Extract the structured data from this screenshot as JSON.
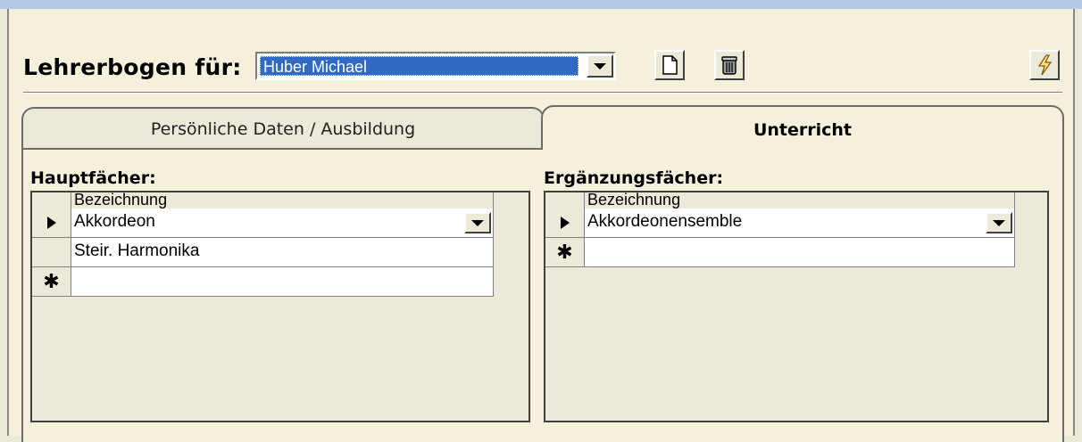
{
  "header": {
    "title": "Lehrerbogen für:",
    "teacher_value": "Huber Michael"
  },
  "toolbar": {
    "new_icon": "document-icon",
    "delete_icon": "trash-icon",
    "action_icon": "lightning-icon"
  },
  "tabs": [
    {
      "label": "Persönliche Daten / Ausbildung",
      "active": false
    },
    {
      "label": "Unterricht",
      "active": true
    }
  ],
  "hauptfaecher": {
    "label": "Hauptfächer:",
    "column": "Bezeichnung",
    "rows": [
      "Akkordeon",
      "Steir. Harmonika"
    ]
  },
  "ergaenzungsfaecher": {
    "label": "Ergänzungsfächer:",
    "column": "Bezeichnung",
    "rows": [
      "Akkordeonensemble"
    ]
  },
  "new_record_marker": "✱",
  "colors": {
    "selection": "#316ac5",
    "window_top": "#b4c9e6",
    "face": "#ece9d8"
  }
}
